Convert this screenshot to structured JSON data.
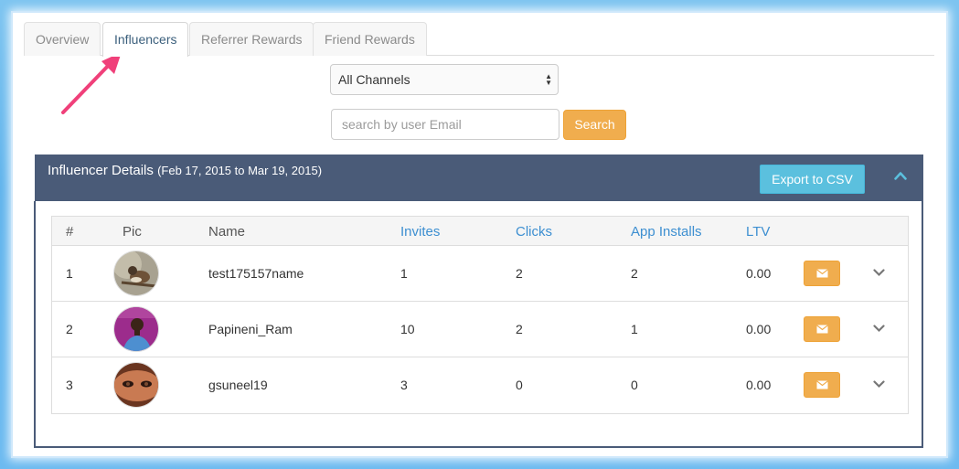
{
  "tabs": [
    {
      "label": "Overview",
      "active": false
    },
    {
      "label": "Influencers",
      "active": true
    },
    {
      "label": "Referrer Rewards",
      "active": false
    },
    {
      "label": "Friend Rewards",
      "active": false
    }
  ],
  "filters": {
    "channel_selected": "All Channels",
    "search_placeholder": "search by user Email",
    "search_button": "Search"
  },
  "panel": {
    "title": "Influencer Details",
    "date_range": "(Feb 17, 2015 to Mar 19, 2015)",
    "export_button": "Export to CSV"
  },
  "table": {
    "columns": [
      "#",
      "Pic",
      "Name",
      "Invites",
      "Clicks",
      "App Installs",
      "LTV"
    ],
    "rows": [
      {
        "num": "1",
        "name": "test175157name",
        "invites": "1",
        "clicks": "2",
        "app_installs": "2",
        "ltv": "0.00"
      },
      {
        "num": "2",
        "name": "Papineni_Ram",
        "invites": "10",
        "clicks": "2",
        "app_installs": "1",
        "ltv": "0.00"
      },
      {
        "num": "3",
        "name": "gsuneel19",
        "invites": "3",
        "clicks": "0",
        "app_installs": "0",
        "ltv": "0.00"
      }
    ]
  },
  "colors": {
    "panel_header": "#4a5b78",
    "accent_orange": "#f0ad4e",
    "accent_cyan": "#5bc0de",
    "annotation_arrow": "#f0407a",
    "sortable_header": "#3d8fd1"
  },
  "icons": [
    "annotation-arrow",
    "select-caret-icon",
    "collapse-chevron-up-icon",
    "envelope-icon",
    "chevron-down-icon"
  ]
}
